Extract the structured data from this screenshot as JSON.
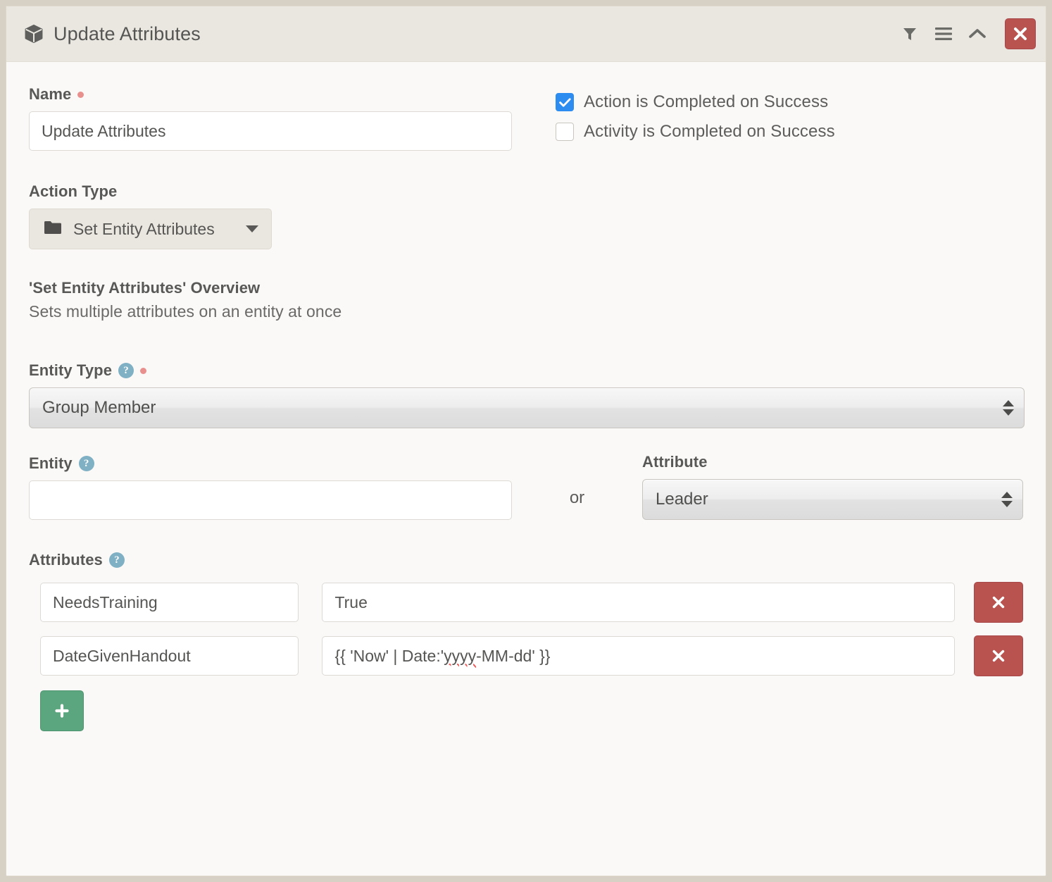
{
  "window": {
    "title": "Update Attributes",
    "icon": "cube-icon",
    "tools": [
      {
        "name": "filter-icon",
        "label": "Filter"
      },
      {
        "name": "menu-icon",
        "label": "Menu"
      },
      {
        "name": "chevron-up-icon",
        "label": "Collapse"
      }
    ],
    "close_label": "×"
  },
  "form": {
    "name": {
      "label": "Name",
      "required": true,
      "value": "Update Attributes",
      "placeholder": ""
    },
    "checkboxes": [
      {
        "label": "Action is Completed on Success",
        "checked": true
      },
      {
        "label": "Activity is Completed on Success",
        "checked": false
      }
    ],
    "action_type": {
      "label": "Action Type",
      "icon": "folder-icon",
      "value": "Set Entity Attributes"
    },
    "overview": {
      "title": "'Set Entity Attributes' Overview",
      "description": "Sets multiple attributes on an entity at once"
    },
    "entity_type": {
      "label": "Entity Type",
      "required": true,
      "has_help": true,
      "value": "Group Member"
    },
    "entity": {
      "label": "Entity",
      "has_help": true,
      "value": "",
      "placeholder": ""
    },
    "or_separator": "or",
    "attribute": {
      "label": "Attribute",
      "value": "Leader"
    },
    "attributes": {
      "label": "Attributes",
      "has_help": true,
      "rows": [
        {
          "key": "NeedsTraining",
          "value": "True",
          "value_pre": "True",
          "value_misspelled": "",
          "value_post": "",
          "delete_label": "×"
        },
        {
          "key": "DateGivenHandout",
          "value": "{{ 'Now' | Date:'yyyy-MM-dd' }}",
          "value_pre": "{{ 'Now' | Date:'",
          "value_misspelled": "yyyy",
          "value_post": "-MM-dd' }}",
          "delete_label": "×"
        }
      ],
      "add_label": "+"
    }
  },
  "colors": {
    "page_background": "#d7d0c5",
    "panel_background": "#faf9f7",
    "header_background": "#eae7e0",
    "accent_checkbox": "#2d8cf0",
    "danger": "#b9534f",
    "success": "#5ca67f",
    "help_icon": "#7fb0c4",
    "required_dot": "#e8908e",
    "text": "#555553"
  }
}
